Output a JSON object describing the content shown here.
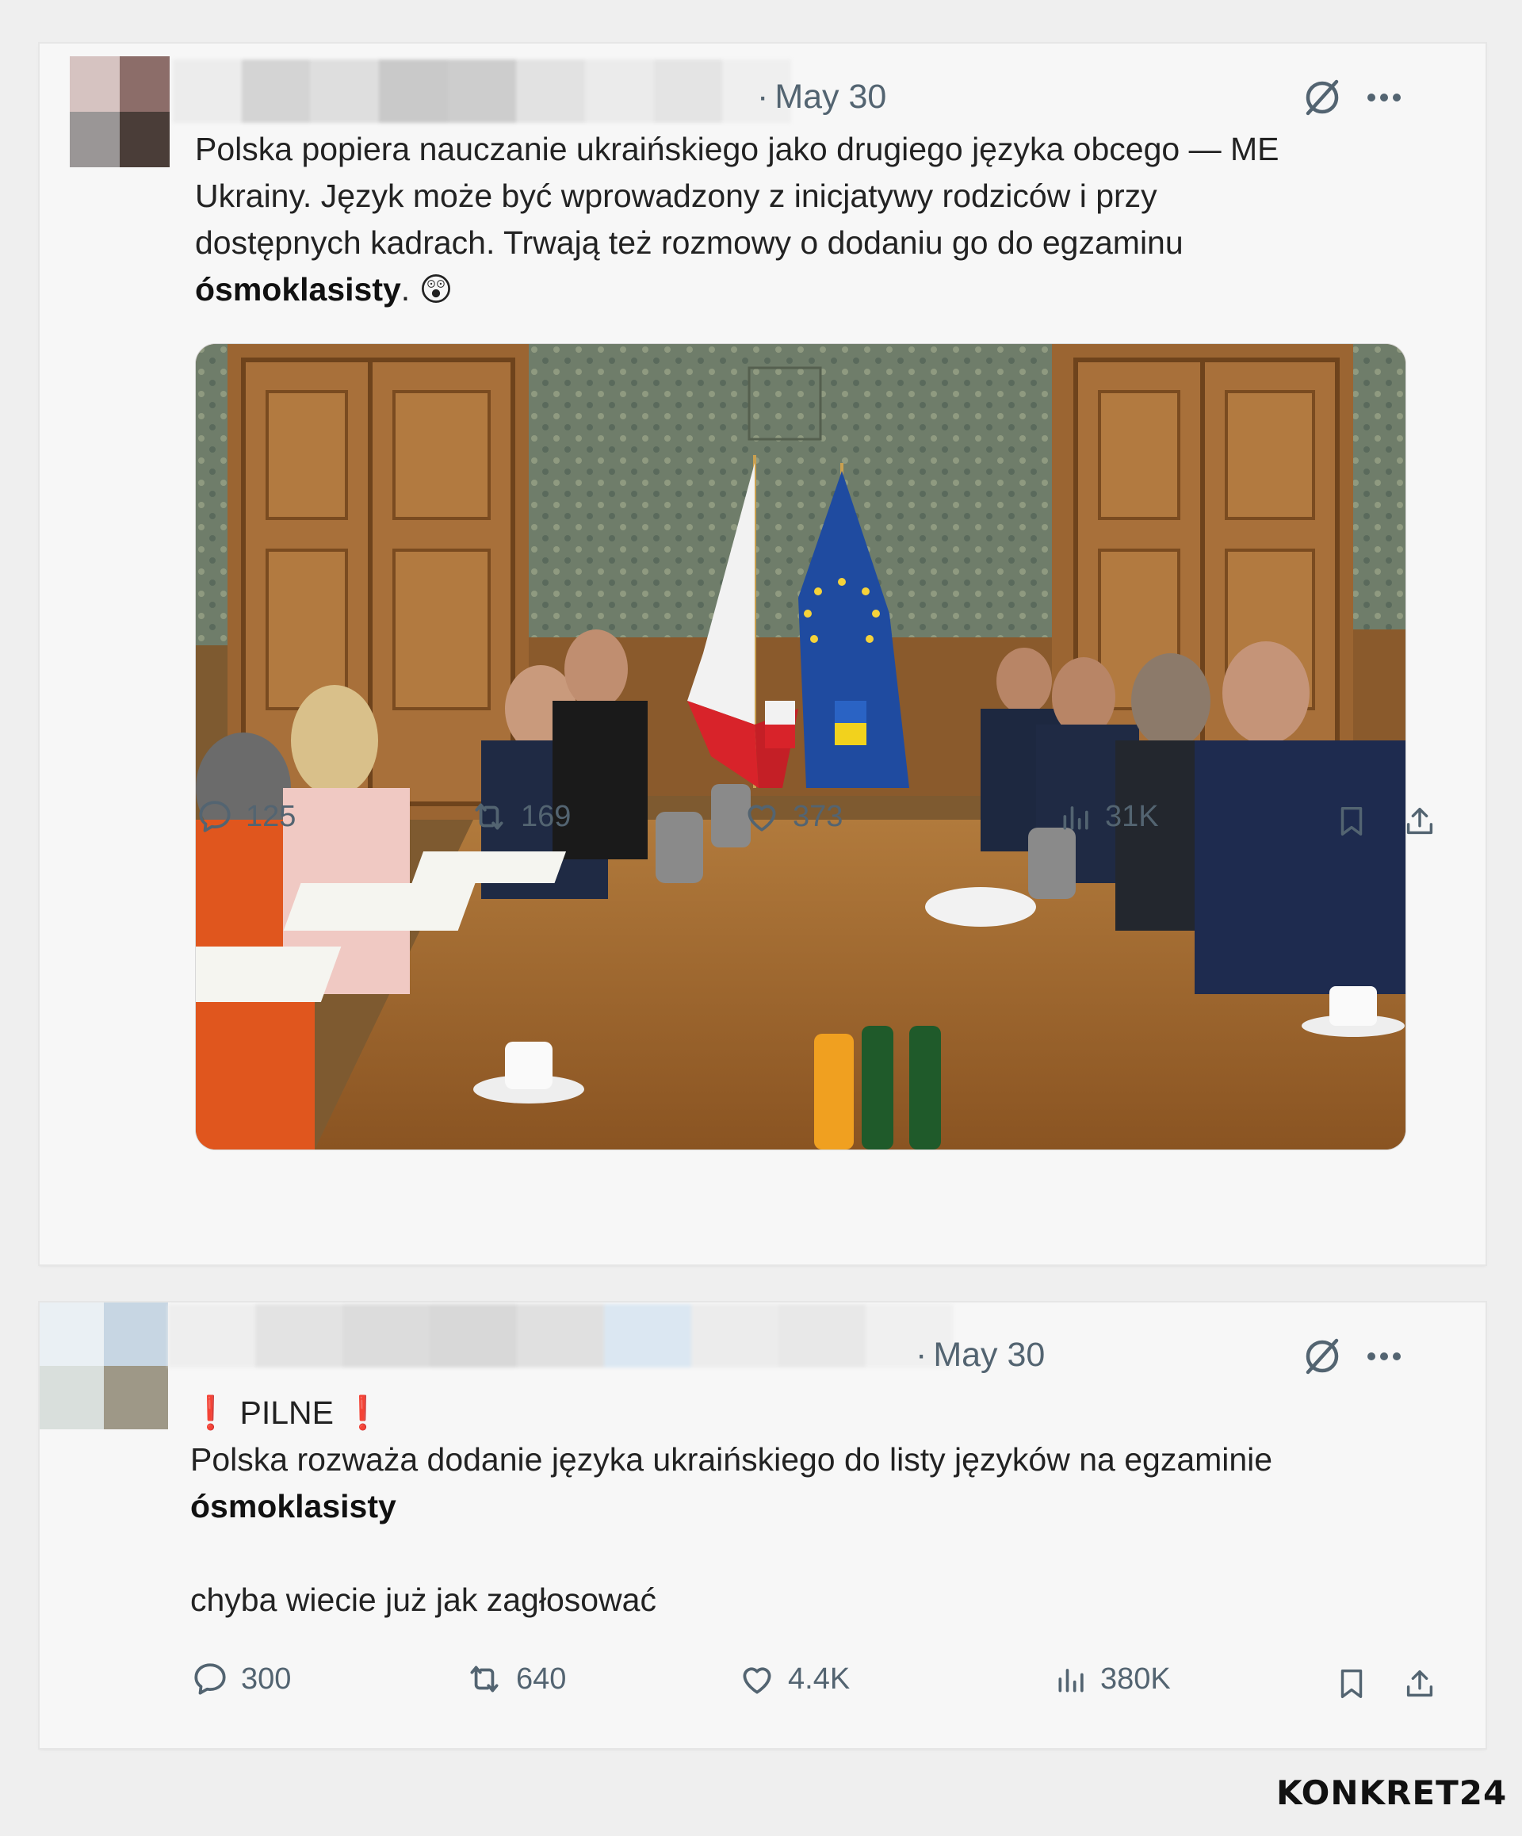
{
  "tweets": [
    {
      "date": "May 30",
      "text_lines": [
        "Polska popiera nauczanie ukraińskiego jako drugiego języka obcego — ME",
        "Ukrainy. Język może być wprowadzony z inicjatywy rodziców i przy",
        "dostępnych kadrach. Trwają też rozmowy o dodaniu go do egzaminu"
      ],
      "bold_word": "ósmoklasisty",
      "trailing": ".",
      "emoji": "😲",
      "image_alt": "Photo of a meeting at a long table with Polish, EU and Ukrainian flags",
      "stats": {
        "replies": "125",
        "reposts": "169",
        "likes": "373",
        "views": "31K"
      },
      "icons": [
        "grok-icon",
        "more-icon",
        "reply-icon",
        "repost-icon",
        "like-icon",
        "views-icon",
        "bookmark-icon",
        "share-icon"
      ]
    },
    {
      "date": "May 30",
      "alert_label": "PILNE",
      "alert_icon": "❗",
      "text_line": "Polska rozważa dodanie języka ukraińskiego do listy języków na egzaminie",
      "bold_word": "ósmoklasisty",
      "text2": "chyba wiecie już jak zagłosować",
      "stats": {
        "replies": "300",
        "reposts": "640",
        "likes": "4.4K",
        "views": "380K"
      }
    }
  ],
  "brand": {
    "name": "KONKRET24"
  },
  "colors": {
    "muted": "#536471",
    "alert": "#e0202a",
    "card": "#f7f7f7"
  }
}
